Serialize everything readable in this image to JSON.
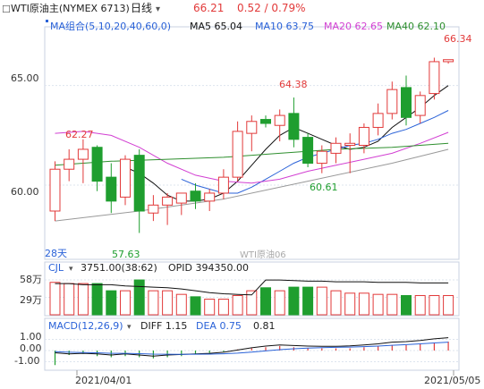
{
  "header": {
    "symbol": "WTI原油主(NYMEX 6713)",
    "period": "日线",
    "period_arrow": "▾",
    "last": "66.21",
    "change": "0.52 / 0.79%",
    "ma_title": "MA组合(5,10,20,40,60,0)",
    "ma_items": [
      {
        "label": "MA5 65.04",
        "color": "#111111"
      },
      {
        "label": "MA10 63.75",
        "color": "#2a62d8"
      },
      {
        "label": "MA20 62.65",
        "color": "#d23fd2"
      },
      {
        "label": "MA40 62.10",
        "color": "#2e8f2e"
      }
    ]
  },
  "price_panel": {
    "y_ticks": [
      "65.00",
      "60.00"
    ],
    "annotations": {
      "high_right": "66.34",
      "high_mid": "64.38",
      "left_high": "62.27",
      "low_left": "57.63",
      "low_mid": "60.61"
    },
    "days_label": "28天",
    "watermark": "WTI原油06"
  },
  "volume_panel": {
    "indicator": "CJL",
    "vol_value": "3751.00(38:62)",
    "opid": "OPID 394350.00",
    "y_ticks": [
      "58万",
      "29万"
    ]
  },
  "macd_panel": {
    "title": "MACD(12,26,9)",
    "diff": "DIFF 1.15",
    "dea": "DEA 0.75",
    "macd": "0.81",
    "y_ticks": [
      "1.00",
      "0.00",
      "-1.00"
    ]
  },
  "x_axis": {
    "left_date": "2021/04/01",
    "right_date": "2021/05/05"
  },
  "chart_data": {
    "type": "candlestick",
    "title": "WTI原油主(NYMEX 6713) 日线",
    "price_axis": {
      "ylim": [
        56.5,
        67.5
      ],
      "ticks": [
        65.0,
        60.0
      ]
    },
    "candles": [
      {
        "o": 58.7,
        "h": 61.2,
        "l": 58.2,
        "c": 60.8
      },
      {
        "o": 60.8,
        "h": 61.8,
        "l": 60.2,
        "c": 61.3
      },
      {
        "o": 61.3,
        "h": 62.3,
        "l": 60.1,
        "c": 61.8
      },
      {
        "o": 61.9,
        "h": 62.0,
        "l": 59.7,
        "c": 60.2
      },
      {
        "o": 60.4,
        "h": 61.1,
        "l": 58.6,
        "c": 59.2
      },
      {
        "o": 59.4,
        "h": 61.5,
        "l": 59.0,
        "c": 61.3
      },
      {
        "o": 61.5,
        "h": 61.8,
        "l": 57.6,
        "c": 58.7
      },
      {
        "o": 58.6,
        "h": 59.5,
        "l": 58.2,
        "c": 59.0
      },
      {
        "o": 59.0,
        "h": 59.6,
        "l": 58.0,
        "c": 59.4
      },
      {
        "o": 59.1,
        "h": 59.5,
        "l": 58.5,
        "c": 59.6
      },
      {
        "o": 59.7,
        "h": 60.1,
        "l": 58.8,
        "c": 59.2
      },
      {
        "o": 59.2,
        "h": 59.8,
        "l": 58.7,
        "c": 59.6
      },
      {
        "o": 59.6,
        "h": 60.8,
        "l": 59.3,
        "c": 60.4
      },
      {
        "o": 60.4,
        "h": 63.2,
        "l": 60.2,
        "c": 62.7
      },
      {
        "o": 62.6,
        "h": 63.5,
        "l": 61.7,
        "c": 63.2
      },
      {
        "o": 63.3,
        "h": 63.5,
        "l": 62.9,
        "c": 63.1
      },
      {
        "o": 63.0,
        "h": 63.8,
        "l": 62.2,
        "c": 63.5
      },
      {
        "o": 63.6,
        "h": 64.4,
        "l": 61.9,
        "c": 62.3
      },
      {
        "o": 62.4,
        "h": 62.6,
        "l": 60.9,
        "c": 61.1
      },
      {
        "o": 61.1,
        "h": 62.0,
        "l": 60.6,
        "c": 61.7
      },
      {
        "o": 61.6,
        "h": 62.4,
        "l": 61.1,
        "c": 62.1
      },
      {
        "o": 62.0,
        "h": 62.6,
        "l": 60.6,
        "c": 62.1
      },
      {
        "o": 62.0,
        "h": 63.1,
        "l": 61.6,
        "c": 62.9
      },
      {
        "o": 62.9,
        "h": 64.1,
        "l": 62.5,
        "c": 63.6
      },
      {
        "o": 63.6,
        "h": 65.2,
        "l": 63.3,
        "c": 64.8
      },
      {
        "o": 64.9,
        "h": 65.5,
        "l": 63.0,
        "c": 63.4
      },
      {
        "o": 63.5,
        "h": 64.7,
        "l": 63.1,
        "c": 64.5
      },
      {
        "o": 64.6,
        "h": 66.4,
        "l": 64.3,
        "c": 66.2
      },
      {
        "o": 66.2,
        "h": 66.3,
        "l": 66.1,
        "c": 66.3
      }
    ],
    "ma_lines": [
      {
        "name": "MA5",
        "color": "#111111",
        "points": [
          [
            5,
            60.9
          ],
          [
            6,
            60.6
          ],
          [
            7,
            60.1
          ],
          [
            8,
            59.5
          ],
          [
            9,
            59.2
          ],
          [
            10,
            59.2
          ],
          [
            11,
            59.3
          ],
          [
            12,
            59.6
          ],
          [
            13,
            60.2
          ],
          [
            14,
            61.0
          ],
          [
            15,
            61.8
          ],
          [
            16,
            62.5
          ],
          [
            17,
            62.9
          ],
          [
            18,
            62.6
          ],
          [
            19,
            62.3
          ],
          [
            20,
            62.0
          ],
          [
            21,
            61.8
          ],
          [
            22,
            61.9
          ],
          [
            23,
            62.2
          ],
          [
            24,
            62.9
          ],
          [
            25,
            63.4
          ],
          [
            26,
            63.9
          ],
          [
            27,
            64.5
          ],
          [
            28,
            65.0
          ]
        ]
      },
      {
        "name": "MA10",
        "color": "#2a62d8",
        "points": [
          [
            9,
            60.3
          ],
          [
            10,
            60.0
          ],
          [
            11,
            59.8
          ],
          [
            12,
            59.6
          ],
          [
            13,
            59.6
          ],
          [
            14,
            59.9
          ],
          [
            15,
            60.3
          ],
          [
            16,
            60.7
          ],
          [
            17,
            61.1
          ],
          [
            18,
            61.4
          ],
          [
            19,
            61.6
          ],
          [
            20,
            61.8
          ],
          [
            21,
            62.0
          ],
          [
            22,
            62.1
          ],
          [
            23,
            62.3
          ],
          [
            24,
            62.6
          ],
          [
            25,
            62.8
          ],
          [
            26,
            63.1
          ],
          [
            27,
            63.4
          ],
          [
            28,
            63.75
          ]
        ]
      },
      {
        "name": "MA20",
        "color": "#d23fd2",
        "points": [
          [
            0,
            62.6
          ],
          [
            2,
            62.7
          ],
          [
            4,
            62.5
          ],
          [
            6,
            61.9
          ],
          [
            8,
            61.1
          ],
          [
            10,
            60.5
          ],
          [
            12,
            60.2
          ],
          [
            14,
            60.1
          ],
          [
            16,
            60.3
          ],
          [
            18,
            60.7
          ],
          [
            20,
            61.0
          ],
          [
            22,
            61.3
          ],
          [
            24,
            61.6
          ],
          [
            26,
            62.1
          ],
          [
            28,
            62.65
          ]
        ]
      },
      {
        "name": "MA40",
        "color": "#2e8f2e",
        "points": [
          [
            0,
            61.0
          ],
          [
            4,
            61.2
          ],
          [
            8,
            61.3
          ],
          [
            12,
            61.4
          ],
          [
            16,
            61.6
          ],
          [
            20,
            61.8
          ],
          [
            24,
            61.9
          ],
          [
            28,
            62.1
          ]
        ]
      },
      {
        "name": "MA60",
        "color": "#999999",
        "points": [
          [
            0,
            58.2
          ],
          [
            6,
            58.7
          ],
          [
            12,
            59.3
          ],
          [
            18,
            60.2
          ],
          [
            24,
            61.1
          ],
          [
            28,
            61.8
          ]
        ]
      }
    ],
    "volume": {
      "values": [
        54,
        52,
        52,
        52,
        40,
        40,
        58,
        40,
        40,
        34,
        30,
        26,
        26,
        32,
        40,
        45,
        40,
        46,
        46,
        46,
        40,
        36,
        36,
        34,
        34,
        32,
        32,
        32,
        32
      ],
      "ylim": [
        0,
        70
      ],
      "ticks": [
        58,
        29
      ],
      "opid_line": [
        52,
        52,
        50,
        50,
        50,
        48,
        47,
        46,
        45,
        43,
        40,
        37,
        35,
        34,
        33,
        58,
        58,
        57,
        56,
        56,
        55,
        55,
        55,
        54,
        54,
        54,
        53,
        53,
        53
      ]
    },
    "macd": {
      "ylim": [
        -1.6,
        1.6
      ],
      "ticks": [
        1.0,
        0.0,
        -1.0
      ],
      "hist": [
        -1.3,
        -0.4,
        -0.3,
        -0.5,
        -0.6,
        -0.5,
        -0.6,
        -0.7,
        -0.6,
        -0.5,
        -0.3,
        -0.2,
        -0.1,
        0.1,
        0.2,
        0.3,
        0.4,
        0.3,
        0.2,
        0.2,
        0.2,
        0.2,
        0.3,
        0.4,
        0.5,
        0.5,
        0.6,
        0.7,
        0.8
      ],
      "diff": [
        -0.2,
        -0.3,
        -0.25,
        -0.3,
        -0.4,
        -0.3,
        -0.4,
        -0.5,
        -0.4,
        -0.35,
        -0.3,
        -0.25,
        -0.15,
        0.05,
        0.25,
        0.4,
        0.5,
        0.45,
        0.4,
        0.38,
        0.38,
        0.42,
        0.5,
        0.6,
        0.75,
        0.8,
        0.9,
        1.05,
        1.15
      ],
      "dea": [
        -0.1,
        -0.15,
        -0.18,
        -0.2,
        -0.25,
        -0.25,
        -0.28,
        -0.32,
        -0.33,
        -0.34,
        -0.33,
        -0.32,
        -0.29,
        -0.23,
        -0.14,
        -0.03,
        0.08,
        0.16,
        0.22,
        0.26,
        0.29,
        0.31,
        0.35,
        0.4,
        0.47,
        0.53,
        0.6,
        0.68,
        0.75
      ]
    },
    "up_color": "#e23a3a",
    "down_color": "#1f9e2f"
  }
}
